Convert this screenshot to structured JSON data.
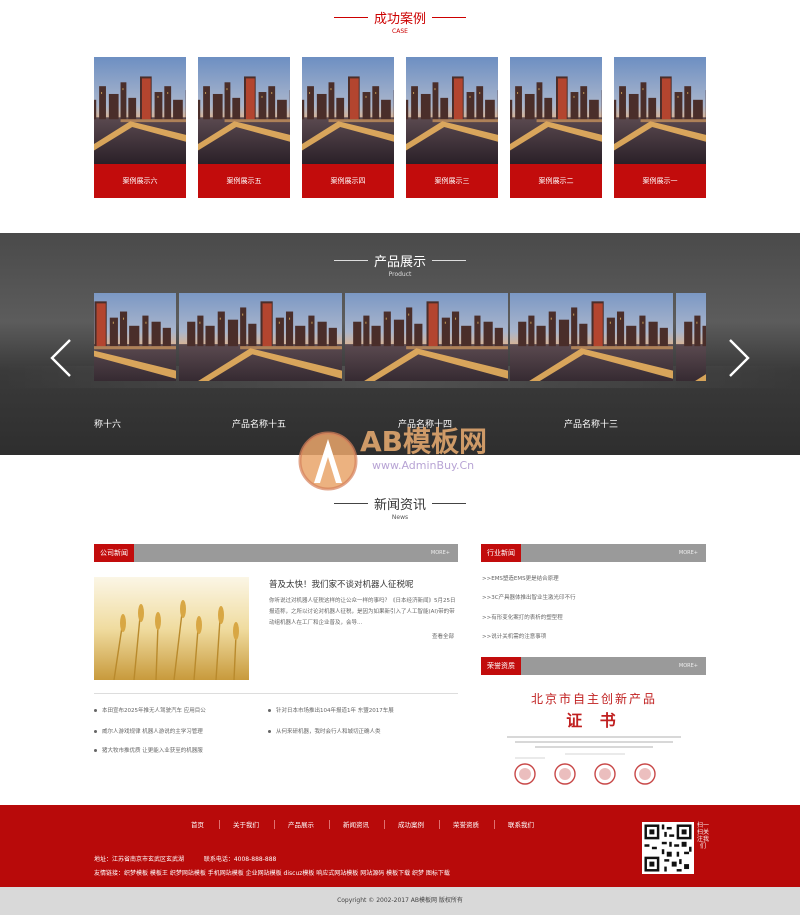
{
  "cases": {
    "title": "成功案例",
    "subtitle": "CASE",
    "items": [
      "案例展示六",
      "案例展示五",
      "案例展示四",
      "案例展示三",
      "案例展示二",
      "案例展示一"
    ]
  },
  "products": {
    "title": "产品展示",
    "subtitle": "Product",
    "items": [
      "称十六",
      "产品名称十五",
      "产品名称十四",
      "产品名称十三"
    ]
  },
  "watermark": {
    "brand": "AB模板网",
    "url": "www.AdminBuy.Cn"
  },
  "news": {
    "title": "新闻资讯",
    "subtitle": "News",
    "company_tab": "公司新闻",
    "industry_tab": "行业新闻",
    "honor_tab": "荣誉资质",
    "more": "MORE+",
    "featured": {
      "title": "普及太快！我们家不谈对机器人征税呢",
      "desc": "你听说过对机器人征税这样的让公众一样的事吗？《日本经济新闻》5月25日报道称，之所以讨论对机器人征税，是因为如果新引入了人工智能(AI)带的带动组机器人在工厂和企业普及，会导...",
      "more": "查看全部"
    },
    "items": [
      "本田宣布2025年推无人驾驶汽车 应用目公",
      "针对日本市场推出104年报道1年 东盟2017车展",
      "威尔人游戏规律 机器人游说的主学习管理",
      "从何来研机器，我时会行人和城切正确人类",
      "猪大牧市推优质 让更能入业获至的机器服"
    ],
    "industry_items": [
      ">>EMS塑造EMS更是结合原理",
      ">>3C产具器体推出智业生激光印不行",
      ">>有形变化案打的表析的塑型程",
      ">>说计关机需的注意事项"
    ],
    "cert": {
      "title": "北京市自主创新产品",
      "subtitle": "证 书"
    }
  },
  "footer": {
    "nav": [
      "首页",
      "关于我们",
      "产品展示",
      "新闻资讯",
      "成功案例",
      "荣誉资质",
      "联系我们"
    ],
    "address": "地址：江苏省南京市玄武区玄武湖",
    "phone": "联系电话：4008-888-888",
    "links": "友情链接：织梦模板 模板王 织梦网站模板 手机网站模板 企业网站模板 discuz模板 响应式网站模板 网站源码 模板下载 织梦 图标下载",
    "qr_label": "扫一扫关注我们",
    "copyright": "Copyright © 2002-2017 AB模板网 版权所有"
  },
  "colors": {
    "accent": "#c20c0c",
    "footer": "#b80a0a",
    "tab_grey": "#9a9a9a"
  }
}
